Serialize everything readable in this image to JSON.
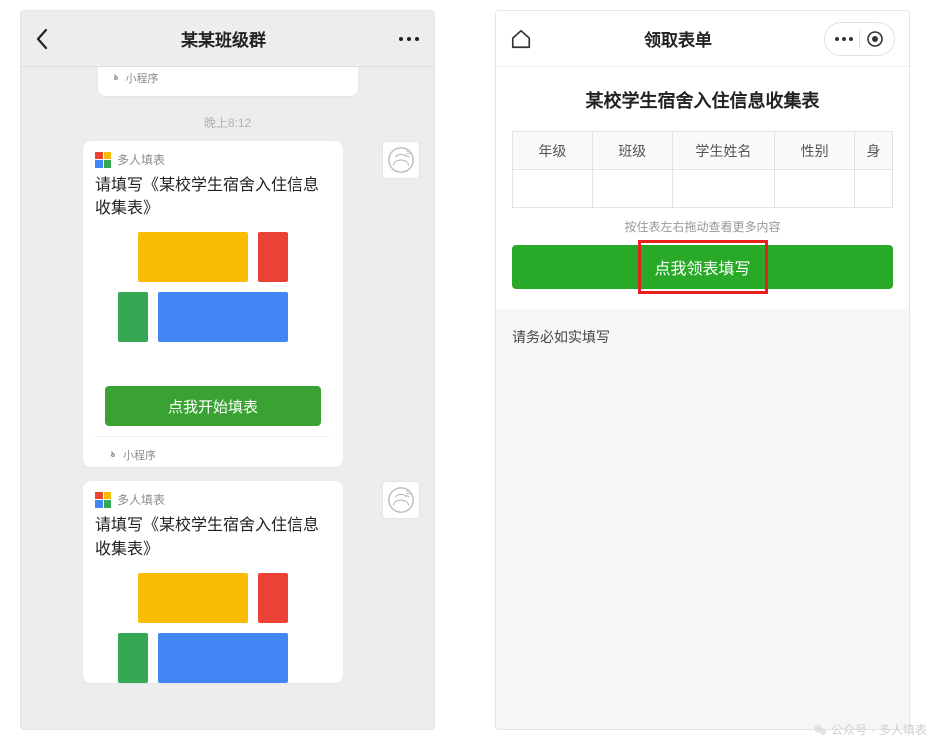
{
  "left": {
    "header": {
      "title": "某某班级群"
    },
    "clip": {
      "miniprogram_label": "小程序"
    },
    "timestamp": "晚上8:12",
    "card": {
      "app_name": "多人填表",
      "title": "请填写《某校学生宿舍入住信息收集表》",
      "start_button": "点我开始填表",
      "miniprogram_label": "小程序"
    }
  },
  "right": {
    "header": {
      "title": "领取表单"
    },
    "form_title": "某校学生宿舍入住信息收集表",
    "columns": [
      "年级",
      "班级",
      "学生姓名",
      "性别",
      "身"
    ],
    "scroll_hint": "按住表左右拖动查看更多内容",
    "claim_button": "点我领表填写",
    "note": "请务必如实填写"
  },
  "watermark": {
    "prefix": "公众号",
    "sep": "·",
    "name": "多人填表"
  }
}
